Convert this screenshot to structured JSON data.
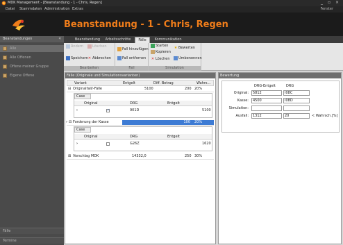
{
  "window": {
    "title": "MDK Management - [Beanstandung - 1 - Chris, Regen]",
    "controls": [
      "_",
      "▫",
      "×"
    ]
  },
  "menu": {
    "items": [
      "Datei",
      "Stammdaten",
      "Administration",
      "Extras"
    ],
    "right": "Fenster"
  },
  "header": {
    "title": "Beanstandung - 1 - Chris, Regen"
  },
  "sidebar": {
    "header": "Beanstandungen",
    "items": [
      {
        "label": "Alle"
      },
      {
        "label": "Alle Offenen"
      },
      {
        "label": "Offene meiner Gruppe"
      },
      {
        "label": "Eigene Offene"
      }
    ],
    "bottom": [
      "Fälle",
      "Termine"
    ]
  },
  "tabs": [
    "Beanstandung",
    "Arbeitsschritte",
    "Fälle",
    "Kommunikation"
  ],
  "active_tab": "Fälle",
  "ribbon": {
    "groups": [
      {
        "label": "Bearbeiten",
        "buttons": [
          {
            "label": "Ändern",
            "icon": "edit-icon"
          },
          {
            "label": "Löschen",
            "icon": "delete-icon"
          },
          {
            "label": "Speichern",
            "icon": "save-icon"
          },
          {
            "label": "Abbrechen",
            "icon": "cancel-icon"
          }
        ]
      },
      {
        "label": "Fall",
        "buttons": [
          {
            "label": "Fall hinzufügen",
            "icon": "add-case-icon"
          },
          {
            "label": "Fall entfernen",
            "icon": "remove-case-icon"
          }
        ]
      },
      {
        "label": "Simulation",
        "buttons": [
          {
            "label": "Starten",
            "icon": "play-icon"
          },
          {
            "label": "Kopieren",
            "icon": "copy-icon"
          },
          {
            "label": "Löschen",
            "icon": "delete-icon"
          },
          {
            "label": "Bewerten",
            "icon": "star-icon"
          },
          {
            "label": "Umbenennen",
            "icon": "rename-icon"
          }
        ]
      }
    ]
  },
  "left_panel": {
    "title": "Fälle (Originale und Simulationsvarianten)",
    "columns": [
      "Variant",
      "Entgelt",
      "Diff. Betrag",
      "Wahrs..."
    ],
    "rows": [
      {
        "expander": "⊟",
        "variant": "Originalfall/-Fälle",
        "entgelt": "5100",
        "diff": "200",
        "wahrs": "20%"
      },
      {
        "expander": "⊟",
        "variant": "Forderung der Kasse",
        "entgelt": "1620",
        "diff": "100",
        "wahrs": "20%"
      },
      {
        "expander": "⊞",
        "variant": "Vorschlag MDK",
        "entgelt": "14332,0",
        "diff": "250",
        "wahrs": "30%"
      }
    ],
    "subgrids": [
      {
        "title": "Case",
        "columns": [
          "Original",
          "DRG",
          "Entgelt"
        ],
        "row": {
          "original_checked": true,
          "drg": "901D",
          "entgelt": "5100"
        }
      },
      {
        "title": "Case",
        "columns": [
          "Original",
          "DRG",
          "Entgelt"
        ],
        "row": {
          "original_checked": false,
          "drg": "G26Z",
          "entgelt": "1620"
        }
      }
    ]
  },
  "right_panel": {
    "title": "Bewertung",
    "col_headers": [
      "DRG-Entgelt",
      "DRG"
    ],
    "rows": [
      {
        "label": "Original:",
        "entgelt": "5812",
        "drg": "I08C"
      },
      {
        "label": "Kasse:",
        "entgelt": "4500",
        "drg": "I08D"
      },
      {
        "label": "Simulation:",
        "entgelt": "",
        "drg": ""
      },
      {
        "label": "Ausfall:",
        "entgelt": "1312",
        "drg": "20"
      }
    ],
    "note": "< Wahrsch.[%]"
  },
  "colors": {
    "accent": "#f07d1a",
    "selection": "#3d7bd4"
  }
}
